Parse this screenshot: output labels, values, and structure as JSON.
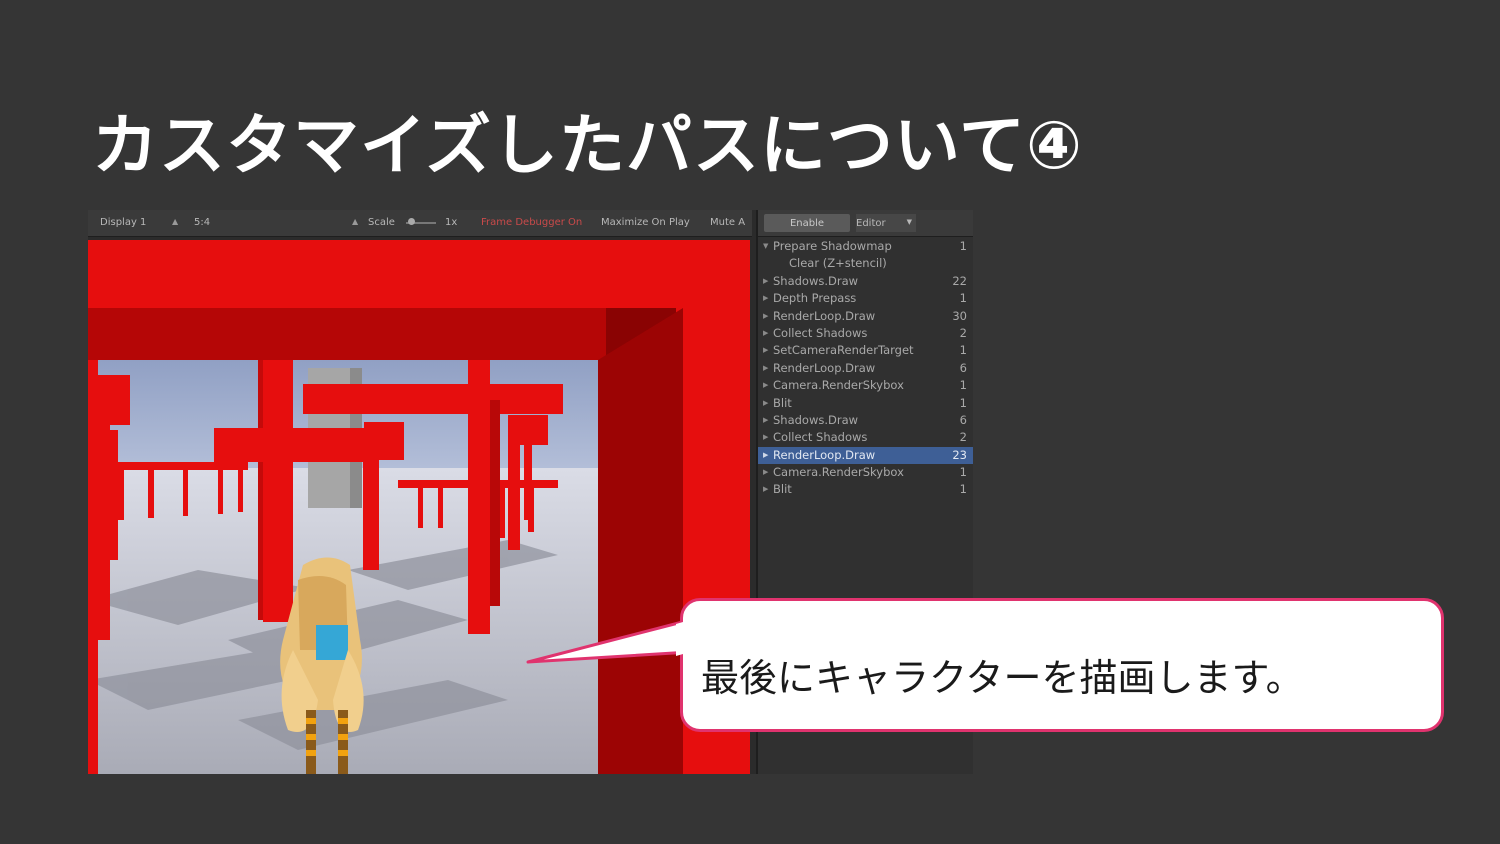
{
  "slide": {
    "title": "カスタマイズしたパスについて④"
  },
  "game_toolbar": {
    "display": "Display 1",
    "aspect": "5:4",
    "scale_label": "Scale",
    "scale_value": "1x",
    "frame_debugger": "Frame Debugger On",
    "maximize": "Maximize On Play",
    "mute": "Mute A"
  },
  "frame_debugger": {
    "enable_label": "Enable",
    "editor_label": "Editor",
    "items": [
      {
        "name": "Prepare Shadowmap",
        "count": "1",
        "expanded": true
      },
      {
        "name": "Clear (Z+stencil)",
        "count": "",
        "sub": true
      },
      {
        "name": "Shadows.Draw",
        "count": "22"
      },
      {
        "name": "Depth Prepass",
        "count": "1"
      },
      {
        "name": "RenderLoop.Draw",
        "count": "30"
      },
      {
        "name": "Collect Shadows",
        "count": "2"
      },
      {
        "name": "SetCameraRenderTarget",
        "count": "1"
      },
      {
        "name": "RenderLoop.Draw",
        "count": "6"
      },
      {
        "name": "Camera.RenderSkybox",
        "count": "1"
      },
      {
        "name": "Blit",
        "count": "1"
      },
      {
        "name": "Shadows.Draw",
        "count": "6"
      },
      {
        "name": "Collect Shadows",
        "count": "2"
      },
      {
        "name": "RenderLoop.Draw",
        "count": "23",
        "selected": true
      },
      {
        "name": "Camera.RenderSkybox",
        "count": "1"
      },
      {
        "name": "Blit",
        "count": "1"
      }
    ]
  },
  "callout": {
    "text": "最後にキャラクターを描画します。"
  },
  "colors": {
    "background": "#353535",
    "torii_red": "#e60e0e",
    "callout_border": "#e0336e",
    "selection": "#3e5f96"
  }
}
